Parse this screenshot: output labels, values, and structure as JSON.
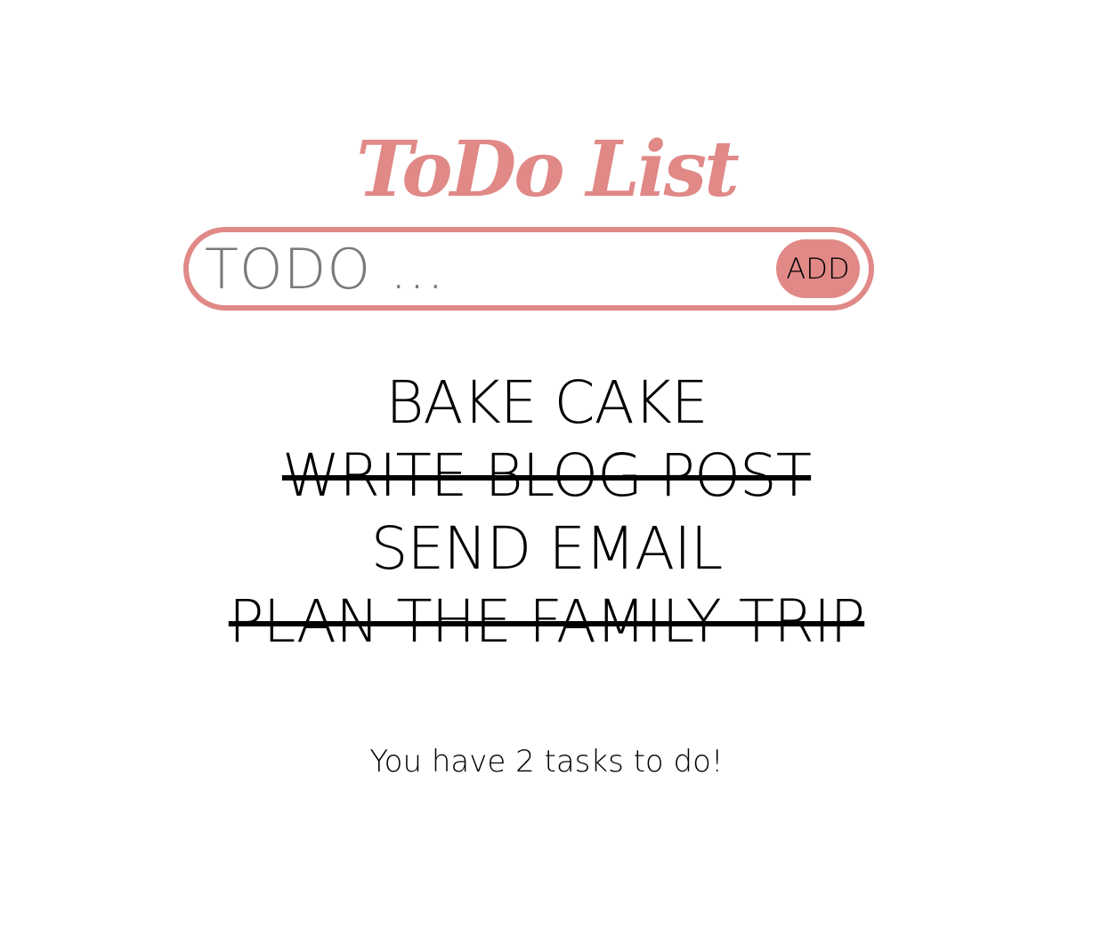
{
  "header": {
    "title": "ToDo List"
  },
  "input": {
    "value": "",
    "placeholder": "TODO ...",
    "add_label": "ADD"
  },
  "tasks": [
    {
      "label": "BAKE CAKE",
      "done": false
    },
    {
      "label": "WRITE BLOG POST",
      "done": true
    },
    {
      "label": "SEND EMAIL",
      "done": false
    },
    {
      "label": "PLAN THE FAMILY TRIP",
      "done": true
    }
  ],
  "footer": {
    "remaining_text": "You have 2 tasks to do!"
  },
  "colors": {
    "accent": "#e08987",
    "text": "#000000",
    "placeholder": "#7a7a7a",
    "background": "#ffffff"
  }
}
